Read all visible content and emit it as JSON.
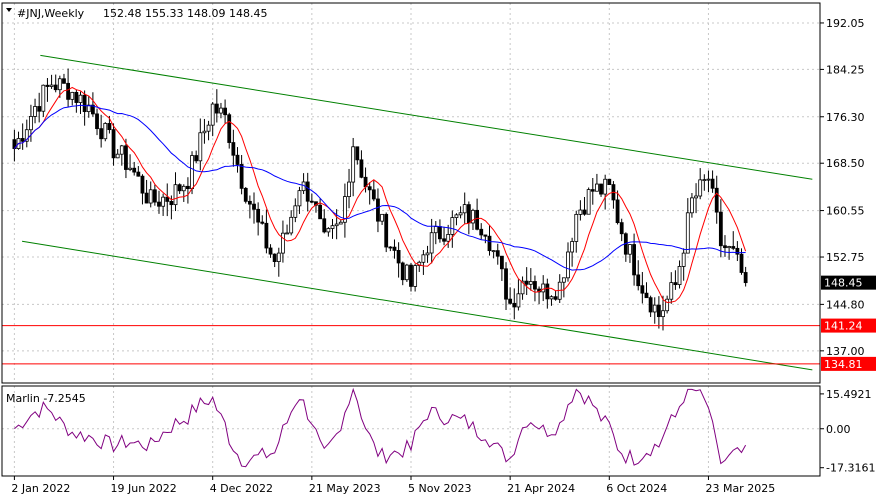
{
  "header": {
    "symbol": "#JNJ,Weekly",
    "ohlc": "152.48 155.33 148.09 148.45"
  },
  "colors": {
    "background": "#ffffff",
    "candle": "#000000",
    "ma_fast": "#ff0000",
    "ma_slow": "#0000ff",
    "channel": "#008000",
    "level": "#ff0000",
    "oscillator": "#800080",
    "grid": "#c8c8c8"
  },
  "chart_data": [
    {
      "type": "candlestick",
      "title": "#JNJ,Weekly",
      "y_ticks": [
        "192.05",
        "184.25",
        "176.30",
        "168.50",
        "160.55",
        "152.75",
        "144.80",
        "137.00"
      ],
      "ylim": [
        131.6,
        195.4
      ],
      "x_ticks": [
        "2 Jan 2022",
        "19 Jun 2022",
        "4 Dec 2022",
        "21 May 2023",
        "5 Nov 2023",
        "21 Apr 2024",
        "6 Oct 2024",
        "23 Mar 2025"
      ],
      "grid": true,
      "last_price_tag": "148.45",
      "horizontal_levels": [
        {
          "value": 141.24,
          "label": "141.24"
        },
        {
          "value": 134.81,
          "label": "134.81"
        }
      ],
      "channel_lines": [
        {
          "name": "upper",
          "x": [
            "2022-02",
            "2025-09"
          ],
          "y": [
            186.6,
            165.8
          ]
        },
        {
          "name": "lower",
          "x": [
            "2022-01",
            "2025-09"
          ],
          "y": [
            155.4,
            133.8
          ]
        }
      ],
      "moving_averages": [
        "fast (red)",
        "slow (blue)"
      ],
      "close_path": [
        [
          "2022-01-02",
          171
        ],
        [
          "2022-02-06",
          178
        ],
        [
          "2022-03-06",
          182
        ],
        [
          "2022-04-03",
          181
        ],
        [
          "2022-05-08",
          178
        ],
        [
          "2022-06-19",
          171
        ],
        [
          "2022-07-17",
          168
        ],
        [
          "2022-08-21",
          162
        ],
        [
          "2022-09-25",
          163
        ],
        [
          "2022-10-23",
          166
        ],
        [
          "2022-12-04",
          178
        ],
        [
          "2022-12-25",
          176
        ],
        [
          "2023-01-22",
          166
        ],
        [
          "2023-02-19",
          158
        ],
        [
          "2023-03-19",
          152
        ],
        [
          "2023-04-09",
          157
        ],
        [
          "2023-04-30",
          165
        ],
        [
          "2023-05-21",
          163
        ],
        [
          "2023-06-11",
          155
        ],
        [
          "2023-07-09",
          158
        ],
        [
          "2023-07-30",
          172
        ],
        [
          "2023-08-20",
          165
        ],
        [
          "2023-09-17",
          158
        ],
        [
          "2023-10-15",
          152
        ],
        [
          "2023-11-05",
          148
        ],
        [
          "2023-12-03",
          155
        ],
        [
          "2024-01-07",
          158
        ],
        [
          "2024-02-04",
          160
        ],
        [
          "2024-03-10",
          158
        ],
        [
          "2024-04-21",
          145
        ],
        [
          "2024-05-19",
          150
        ],
        [
          "2024-06-16",
          147
        ],
        [
          "2024-07-14",
          148
        ],
        [
          "2024-08-11",
          160
        ],
        [
          "2024-09-08",
          164
        ],
        [
          "2024-10-06",
          164
        ],
        [
          "2024-11-03",
          155
        ],
        [
          "2024-12-01",
          148
        ],
        [
          "2024-12-29",
          143
        ],
        [
          "2025-01-26",
          148
        ],
        [
          "2025-02-23",
          162
        ],
        [
          "2025-03-23",
          166
        ],
        [
          "2025-04-13",
          155
        ],
        [
          "2025-05-04",
          153
        ],
        [
          "2025-05-25",
          148.45
        ]
      ]
    },
    {
      "type": "line",
      "title": "Marlin -7.2545",
      "indicator_name": "Marlin",
      "last_value": "-7.2545",
      "y_ticks": [
        "15.4921",
        "0.00",
        "-17.3161"
      ],
      "ylim": [
        -21,
        19
      ],
      "grid": true
    }
  ],
  "sample_rate": "weekly"
}
